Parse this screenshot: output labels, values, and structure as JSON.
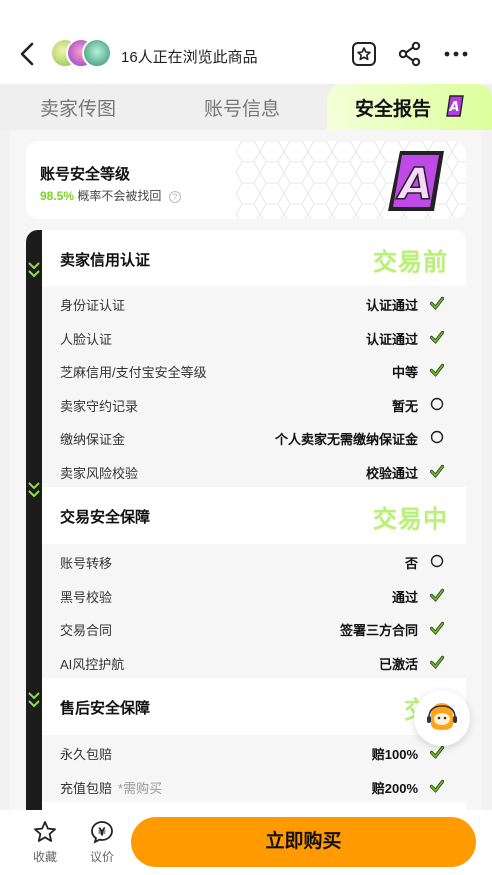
{
  "header": {
    "browse_text": "16人正在浏览此商品",
    "icons": [
      "back-arrow-icon",
      "star-badge-icon",
      "share-icon",
      "more-icon"
    ]
  },
  "tabs": {
    "items": [
      {
        "label": "卖家传图",
        "active": false
      },
      {
        "label": "账号信息",
        "active": false
      },
      {
        "label": "安全报告",
        "active": true
      }
    ],
    "badge": "A"
  },
  "grade_card": {
    "title": "账号安全等级",
    "percent": "98.5%",
    "desc": "概率不会被找回",
    "help": "?",
    "grade": "A"
  },
  "sections": [
    {
      "title": "卖家信用认证",
      "stamp": "交易前",
      "rows": [
        {
          "label": "身份证认证",
          "value": "认证通过",
          "status": "check"
        },
        {
          "label": "人脸认证",
          "value": "认证通过",
          "status": "check"
        },
        {
          "label": "芝麻信用/支付宝安全等级",
          "value": "中等",
          "status": "check"
        },
        {
          "label": "卖家守约记录",
          "value": "暂无",
          "status": "circle"
        },
        {
          "label": "缴纳保证金",
          "value": "个人卖家无需缴纳保证金",
          "status": "circle"
        },
        {
          "label": "卖家风险校验",
          "value": "校验通过",
          "status": "check"
        }
      ]
    },
    {
      "title": "交易安全保障",
      "stamp": "交易中",
      "rows": [
        {
          "label": "账号转移",
          "value": "否",
          "status": "circle"
        },
        {
          "label": "黑号校验",
          "value": "通过",
          "status": "check"
        },
        {
          "label": "交易合同",
          "value": "签署三方合同",
          "status": "check"
        },
        {
          "label": "AI风控护航",
          "value": "已激活",
          "status": "check"
        }
      ]
    },
    {
      "title": "售后安全保障",
      "stamp": "交易",
      "rows": [
        {
          "label": "永久包赔",
          "note": "",
          "value": "赔100%",
          "status": "check"
        },
        {
          "label": "充值包赔",
          "note": "*需购买",
          "value": "赔200%",
          "status": "check"
        }
      ]
    }
  ],
  "bottom": {
    "favorite_label": "收藏",
    "bargain_label": "议价",
    "bargain_symbol": "¥",
    "buy_label": "立即购买"
  },
  "colors": {
    "accent_orange": "#ff9a00",
    "check_green": "#6cc51b",
    "tab_highlight": "#dcff9c",
    "grade_purple": "#b23ce0"
  }
}
